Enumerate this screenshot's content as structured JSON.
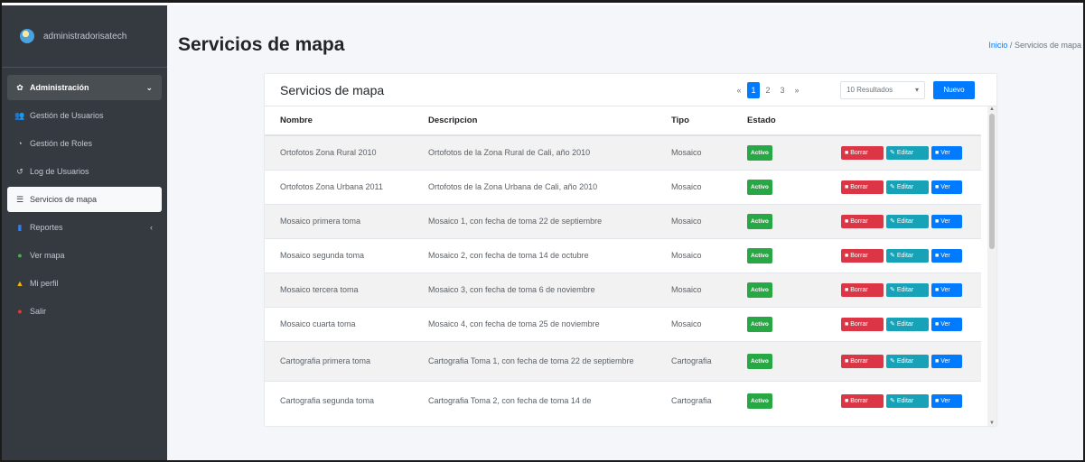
{
  "sidebar": {
    "user_name": "administradorisatech",
    "items": [
      {
        "label": "Administración",
        "icon": "gear-icon",
        "glyph": "✿",
        "caret": "⌄"
      },
      {
        "label": "Gestión de Usuarios",
        "icon": "users-icon",
        "glyph": "👥"
      },
      {
        "label": "Gestión de Roles",
        "icon": "roles-icon",
        "glyph": "◔"
      },
      {
        "label": "Log de Usuarios",
        "icon": "history-icon",
        "glyph": "↺"
      },
      {
        "label": "Servicios de mapa",
        "icon": "list-icon",
        "glyph": "☰"
      },
      {
        "label": "Reportes",
        "icon": "chart-icon",
        "glyph": "▮",
        "caret": "‹"
      },
      {
        "label": "Ver mapa",
        "icon": "globe-icon",
        "glyph": "●"
      },
      {
        "label": "Mi perfil",
        "icon": "user-icon",
        "glyph": "▲"
      },
      {
        "label": "Salir",
        "icon": "power-icon",
        "glyph": "●"
      }
    ]
  },
  "header": {
    "title": "Servicios de mapa",
    "breadcrumb_home": "Inicio",
    "breadcrumb_sep": "/",
    "breadcrumb_current": "Servicios de mapa"
  },
  "card": {
    "title": "Servicios de mapa",
    "pager": {
      "prev": "«",
      "pages": [
        "1",
        "2",
        "3"
      ],
      "next": "»"
    },
    "results_label": "10 Resultados",
    "results_arrow": "▾",
    "new_label": "Nuevo"
  },
  "table": {
    "columns": [
      "Nombre",
      "Descripcion",
      "Tipo",
      "Estado"
    ],
    "rows": [
      {
        "nombre": "Ortofotos Zona Rural 2010",
        "descripcion": "Ortofotos de la Zona Rural de Cali, año 2010",
        "tipo": "Mosaico",
        "estado": "Activo"
      },
      {
        "nombre": "Ortofotos Zona Urbana 2011",
        "descripcion": "Ortofotos de la Zona Urbana de Cali, año 2010",
        "tipo": "Mosaico",
        "estado": "Activo"
      },
      {
        "nombre": "Mosaico primera toma",
        "descripcion": "Mosaico 1, con fecha de toma 22 de septiembre",
        "tipo": "Mosaico",
        "estado": "Activo"
      },
      {
        "nombre": "Mosaico segunda toma",
        "descripcion": "Mosaico 2, con fecha de toma 14 de octubre",
        "tipo": "Mosaico",
        "estado": "Activo"
      },
      {
        "nombre": "Mosaico tercera toma",
        "descripcion": "Mosaico 3, con fecha de toma 6 de noviembre",
        "tipo": "Mosaico",
        "estado": "Activo"
      },
      {
        "nombre": "Mosaico cuarta toma",
        "descripcion": "Mosaico 4, con fecha de toma 25 de noviembre",
        "tipo": "Mosaico",
        "estado": "Activo"
      },
      {
        "nombre": "Cartografia primera toma",
        "descripcion": "Cartografia Toma 1, con fecha de toma 22 de septiembre",
        "tipo": "Cartografia",
        "estado": "Activo"
      },
      {
        "nombre": "Cartografia segunda toma",
        "descripcion": "Cartografia Toma 2, con fecha de toma 14 de",
        "tipo": "Cartografia",
        "estado": "Activo"
      }
    ],
    "actions": {
      "delete": "Borrar",
      "edit": "Editar",
      "view": "Ver"
    }
  },
  "colors": {
    "sidebar_bg": "#343a40",
    "primary": "#007bff",
    "danger": "#dc3545",
    "info": "#17a2b8",
    "success": "#28a745"
  }
}
